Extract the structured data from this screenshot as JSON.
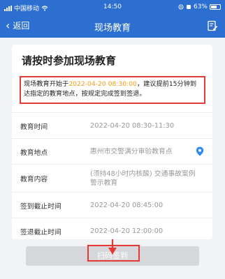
{
  "status_bar": {
    "carrier": "中国移动",
    "time": "14:50",
    "battery": "63%",
    "battery_level": 0.63
  },
  "nav": {
    "back_label": "返回",
    "title": "现场教育",
    "action_icon": "document-edit-icon"
  },
  "card": {
    "title": "请按时参加现场教育",
    "notice": {
      "prefix": "现场教育开始于",
      "highlight": "2022-04-20 08:30:00",
      "suffix": "，建议提前15分钟到达指定的教育地点，按规定完成签到签退。"
    },
    "rows": [
      {
        "label": "教育时间",
        "value": "2022-04-20 08:30-11:30"
      },
      {
        "label": "教育地点",
        "value": "惠州市交警满分审验教育点"
      },
      {
        "label": "教育内容",
        "value": "(须持48小时内核酸) 交通事故案例警示教育"
      },
      {
        "label": "签到截止时间",
        "value": "2022-04-20 08:45:00"
      },
      {
        "label": "签退截止时间",
        "value": "2022-04-20 12:00:00"
      }
    ]
  },
  "action_button": {
    "label": "扫码签到",
    "enabled": false
  },
  "colors": {
    "header": "#2d6fd0",
    "highlight": "#f39c12",
    "annotation": "#e53935",
    "location_icon": "#2d8cf0"
  }
}
